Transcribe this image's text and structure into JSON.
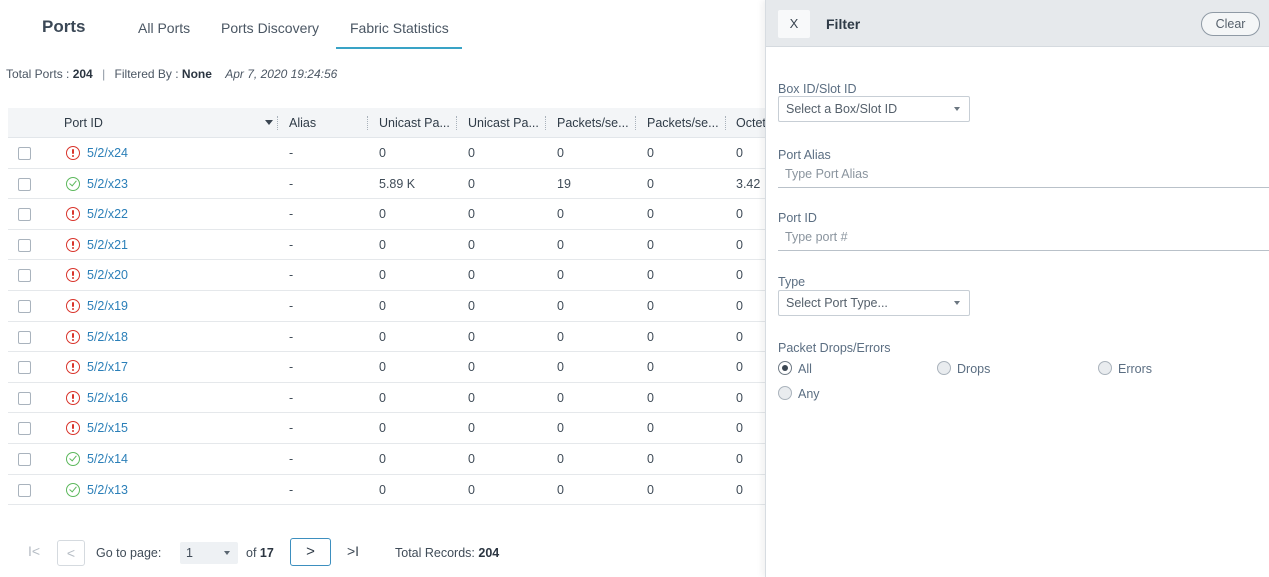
{
  "header": {
    "title": "Ports",
    "tabs": [
      {
        "label": "All Ports"
      },
      {
        "label": "Ports Discovery"
      },
      {
        "label": "Fabric Statistics",
        "active": true
      }
    ]
  },
  "summary": {
    "total_label": "Total Ports : ",
    "total_value": "204",
    "separator": "|",
    "filtered_label": "Filtered By : ",
    "filtered_value": "None",
    "timestamp": "Apr 7, 2020 19:24:56"
  },
  "table": {
    "columns": [
      "Port ID",
      "Alias",
      "Unicast Pa...",
      "Unicast Pa...",
      "Packets/se...",
      "Packets/se...",
      "Octet"
    ],
    "rows": [
      {
        "status": "error",
        "port_id": "5/2/x24",
        "alias": "-",
        "c3": "0",
        "c4": "0",
        "c5": "0",
        "c6": "0",
        "c7": "0"
      },
      {
        "status": "ok",
        "port_id": "5/2/x23",
        "alias": "-",
        "c3": "5.89 K",
        "c4": "0",
        "c5": "19",
        "c6": "0",
        "c7": "3.42"
      },
      {
        "status": "error",
        "port_id": "5/2/x22",
        "alias": "-",
        "c3": "0",
        "c4": "0",
        "c5": "0",
        "c6": "0",
        "c7": "0"
      },
      {
        "status": "error",
        "port_id": "5/2/x21",
        "alias": "-",
        "c3": "0",
        "c4": "0",
        "c5": "0",
        "c6": "0",
        "c7": "0"
      },
      {
        "status": "error",
        "port_id": "5/2/x20",
        "alias": "-",
        "c3": "0",
        "c4": "0",
        "c5": "0",
        "c6": "0",
        "c7": "0"
      },
      {
        "status": "error",
        "port_id": "5/2/x19",
        "alias": "-",
        "c3": "0",
        "c4": "0",
        "c5": "0",
        "c6": "0",
        "c7": "0"
      },
      {
        "status": "error",
        "port_id": "5/2/x18",
        "alias": "-",
        "c3": "0",
        "c4": "0",
        "c5": "0",
        "c6": "0",
        "c7": "0"
      },
      {
        "status": "error",
        "port_id": "5/2/x17",
        "alias": "-",
        "c3": "0",
        "c4": "0",
        "c5": "0",
        "c6": "0",
        "c7": "0"
      },
      {
        "status": "error",
        "port_id": "5/2/x16",
        "alias": "-",
        "c3": "0",
        "c4": "0",
        "c5": "0",
        "c6": "0",
        "c7": "0"
      },
      {
        "status": "error",
        "port_id": "5/2/x15",
        "alias": "-",
        "c3": "0",
        "c4": "0",
        "c5": "0",
        "c6": "0",
        "c7": "0"
      },
      {
        "status": "ok",
        "port_id": "5/2/x14",
        "alias": "-",
        "c3": "0",
        "c4": "0",
        "c5": "0",
        "c6": "0",
        "c7": "0"
      },
      {
        "status": "ok",
        "port_id": "5/2/x13",
        "alias": "-",
        "c3": "0",
        "c4": "0",
        "c5": "0",
        "c6": "0",
        "c7": "0"
      }
    ]
  },
  "pagination": {
    "first_icon": "first-page-icon",
    "prev_glyph": "<",
    "goto_label": "Go to page:",
    "current_page": "1",
    "of_label": "of ",
    "total_pages": "17",
    "next_glyph": ">",
    "last_glyph": ">I",
    "first_glyph": "I<",
    "total_records_label": "Total Records: ",
    "total_records": "204"
  },
  "filter": {
    "close_label": "X",
    "title": "Filter",
    "clear_label": "Clear",
    "box_slot_label": "Box ID/Slot ID",
    "box_slot_placeholder": "Select a Box/Slot ID",
    "port_alias_label": "Port Alias",
    "port_alias_placeholder": "Type Port Alias",
    "port_id_label": "Port ID",
    "port_id_placeholder": "Type port #",
    "type_label": "Type",
    "type_placeholder": "Select Port Type...",
    "drops_errors_label": "Packet Drops/Errors",
    "options": [
      {
        "label": "All",
        "selected": true
      },
      {
        "label": "Drops",
        "selected": false
      },
      {
        "label": "Errors",
        "selected": false
      },
      {
        "label": "Any",
        "selected": false
      }
    ]
  },
  "colors": {
    "accent": "#39a3c6",
    "link": "#2b7fb8",
    "error": "#d9342b",
    "ok": "#5cb85c"
  }
}
